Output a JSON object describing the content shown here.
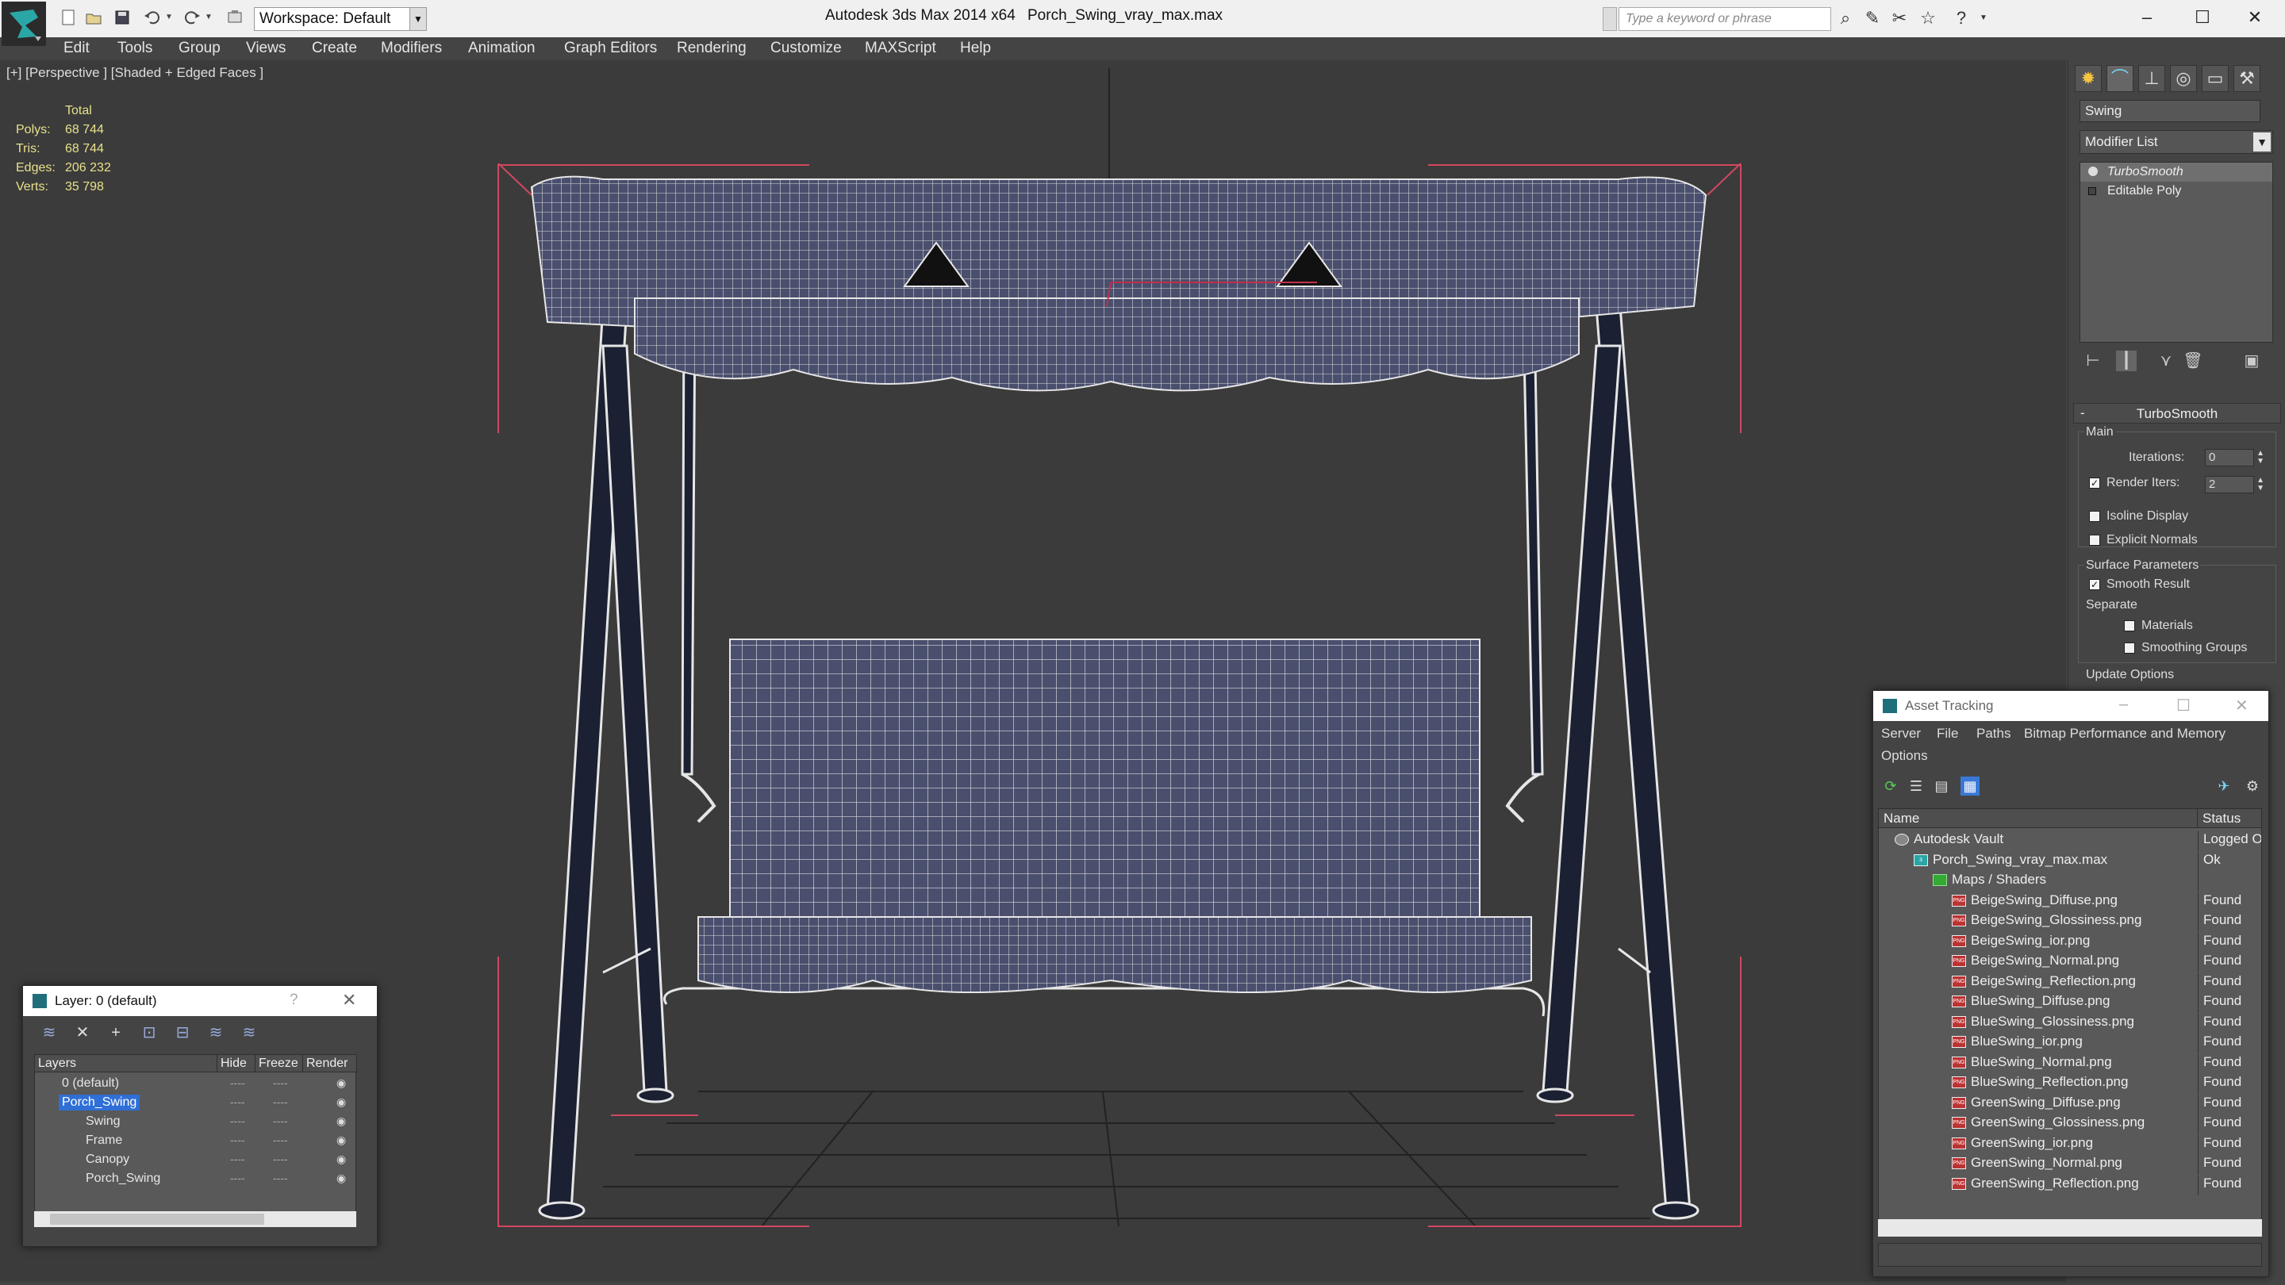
{
  "titlebar": {
    "workspace": "Workspace: Default",
    "app_name": "Autodesk 3ds Max  2014 x64",
    "file_name": "Porch_Swing_vray_max.max",
    "search_placeholder": "Type a keyword or phrase"
  },
  "menu": [
    "Edit",
    "Tools",
    "Group",
    "Views",
    "Create",
    "Modifiers",
    "Animation",
    "Graph Editors",
    "Rendering",
    "Customize",
    "MAXScript",
    "Help"
  ],
  "viewport": {
    "label": "[+] [Perspective ] [Shaded + Edged Faces ]",
    "stats_header": "Total",
    "stats": [
      {
        "key": "Polys:",
        "value": "68 744"
      },
      {
        "key": "Tris:",
        "value": "68 744"
      },
      {
        "key": "Edges:",
        "value": "206 232"
      },
      {
        "key": "Verts:",
        "value": "35 798"
      }
    ]
  },
  "command_panel": {
    "object_name": "Swing",
    "modifier_list": "Modifier List",
    "stack": [
      "TurboSmooth",
      "Editable Poly"
    ],
    "rollout_title": "TurboSmooth",
    "main_group": "Main",
    "iterations_label": "Iterations:",
    "iterations_value": "0",
    "render_iters_label": "Render Iters:",
    "render_iters_value": "2",
    "isoline_label": "Isoline Display",
    "explicit_normals_label": "Explicit Normals",
    "surface_group": "Surface Parameters",
    "smooth_result_label": "Smooth Result",
    "separate_label": "Separate",
    "materials_label": "Materials",
    "smoothing_groups_label": "Smoothing Groups",
    "update_options": "Update Options"
  },
  "layer_dialog": {
    "title": "Layer: 0 (default)",
    "columns": [
      "Layers",
      "Hide",
      "Freeze",
      "Render"
    ],
    "rows": [
      {
        "name": "0 (default)",
        "indent": 0,
        "selected": false
      },
      {
        "name": "Porch_Swing",
        "indent": 0,
        "selected": true
      },
      {
        "name": "Swing",
        "indent": 1,
        "selected": false
      },
      {
        "name": "Frame",
        "indent": 1,
        "selected": false
      },
      {
        "name": "Canopy",
        "indent": 1,
        "selected": false
      },
      {
        "name": "Porch_Swing",
        "indent": 1,
        "selected": false
      }
    ]
  },
  "asset_tracking": {
    "title": "Asset Tracking",
    "menu": [
      "Server",
      "File",
      "Paths",
      "Bitmap Performance and Memory",
      "Options"
    ],
    "columns": [
      "Name",
      "Status"
    ],
    "rows": [
      {
        "name": "Autodesk Vault",
        "status": "Logged O",
        "level": 0,
        "icon": "vault"
      },
      {
        "name": "Porch_Swing_vray_max.max",
        "status": "Ok",
        "level": 1,
        "icon": "max"
      },
      {
        "name": "Maps / Shaders",
        "status": "",
        "level": 2,
        "icon": "folder"
      },
      {
        "name": "BeigeSwing_Diffuse.png",
        "status": "Found",
        "level": 3,
        "icon": "png"
      },
      {
        "name": "BeigeSwing_Glossiness.png",
        "status": "Found",
        "level": 3,
        "icon": "png"
      },
      {
        "name": "BeigeSwing_ior.png",
        "status": "Found",
        "level": 3,
        "icon": "png"
      },
      {
        "name": "BeigeSwing_Normal.png",
        "status": "Found",
        "level": 3,
        "icon": "png"
      },
      {
        "name": "BeigeSwing_Reflection.png",
        "status": "Found",
        "level": 3,
        "icon": "png"
      },
      {
        "name": "BlueSwing_Diffuse.png",
        "status": "Found",
        "level": 3,
        "icon": "png"
      },
      {
        "name": "BlueSwing_Glossiness.png",
        "status": "Found",
        "level": 3,
        "icon": "png"
      },
      {
        "name": "BlueSwing_ior.png",
        "status": "Found",
        "level": 3,
        "icon": "png"
      },
      {
        "name": "BlueSwing_Normal.png",
        "status": "Found",
        "level": 3,
        "icon": "png"
      },
      {
        "name": "BlueSwing_Reflection.png",
        "status": "Found",
        "level": 3,
        "icon": "png"
      },
      {
        "name": "GreenSwing_Diffuse.png",
        "status": "Found",
        "level": 3,
        "icon": "png"
      },
      {
        "name": "GreenSwing_Glossiness.png",
        "status": "Found",
        "level": 3,
        "icon": "png"
      },
      {
        "name": "GreenSwing_ior.png",
        "status": "Found",
        "level": 3,
        "icon": "png"
      },
      {
        "name": "GreenSwing_Normal.png",
        "status": "Found",
        "level": 3,
        "icon": "png"
      },
      {
        "name": "GreenSwing_Reflection.png",
        "status": "Found",
        "level": 3,
        "icon": "png"
      }
    ]
  },
  "colors": {
    "viewport_bg": "#3b3b3b",
    "mesh_fill": "#4a4f6e",
    "wire": "#e6e6e6",
    "bracket": "#d04860",
    "stats": "#e8e08a",
    "selection": "#2f6fd6"
  }
}
